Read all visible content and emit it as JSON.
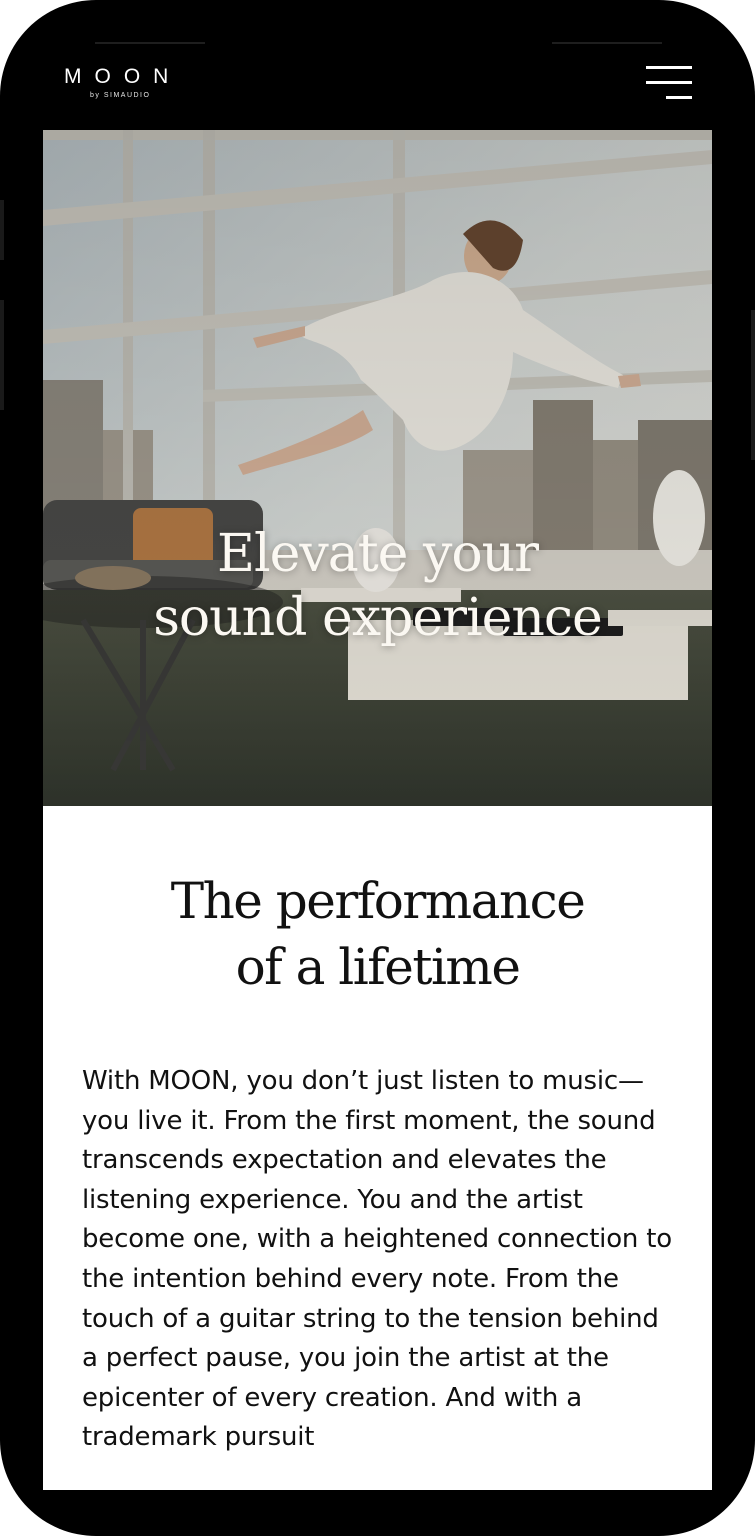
{
  "header": {
    "logo_main": "MOON",
    "logo_sub": "by SIMAUDIO",
    "menu_icon": "hamburger-menu-icon"
  },
  "hero": {
    "title_line1": "Elevate your",
    "title_line2": "sound experience"
  },
  "section": {
    "title_line1": "The performance",
    "title_line2": "of a lifetime",
    "body": "With MOON, you don’t just listen to music—you live it. From the first moment, the sound transcends expectation and elevates the listening experience. You and the artist become one, with a heightened connection to the intention behind every note. From the touch of a guitar string to the tension behind a perfect pause, you join the artist at the epicenter of every creation. And with a trademark pursuit"
  },
  "colors": {
    "frame": "#000000",
    "header_text": "#ffffff",
    "hero_title": "#fbf8f2",
    "body_text": "#111111",
    "content_bg": "#ffffff"
  }
}
